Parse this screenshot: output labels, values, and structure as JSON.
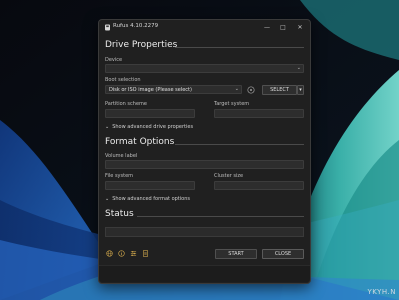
{
  "window": {
    "title": "Rufus 4.10.2279",
    "min_glyph": "—",
    "max_glyph": "□",
    "close_glyph": "✕"
  },
  "drive_properties": {
    "heading": "Drive Properties",
    "device_label": "Device",
    "device_value": "",
    "boot_label": "Boot selection",
    "boot_value": "Disk or ISO image (Please select)",
    "select_label": "SELECT",
    "partition_label": "Partition scheme",
    "partition_value": "",
    "target_label": "Target system",
    "target_value": "",
    "advanced_toggle": "Show advanced drive properties"
  },
  "format_options": {
    "heading": "Format Options",
    "volume_label": "Volume label",
    "volume_value": "",
    "fs_label": "File system",
    "fs_value": "",
    "cluster_label": "Cluster size",
    "cluster_value": "",
    "advanced_toggle": "Show advanced format options"
  },
  "status": {
    "heading": "Status",
    "text": ""
  },
  "footer": {
    "start_label": "START",
    "close_label": "CLOSE"
  },
  "watermark": "YKYH.N",
  "colors": {
    "window_bg": "#202020",
    "field_bg": "#2d2d2d",
    "accent": "#3b8bd6"
  },
  "icons": [
    "globe-icon",
    "info-icon",
    "settings-icon",
    "log-icon"
  ]
}
